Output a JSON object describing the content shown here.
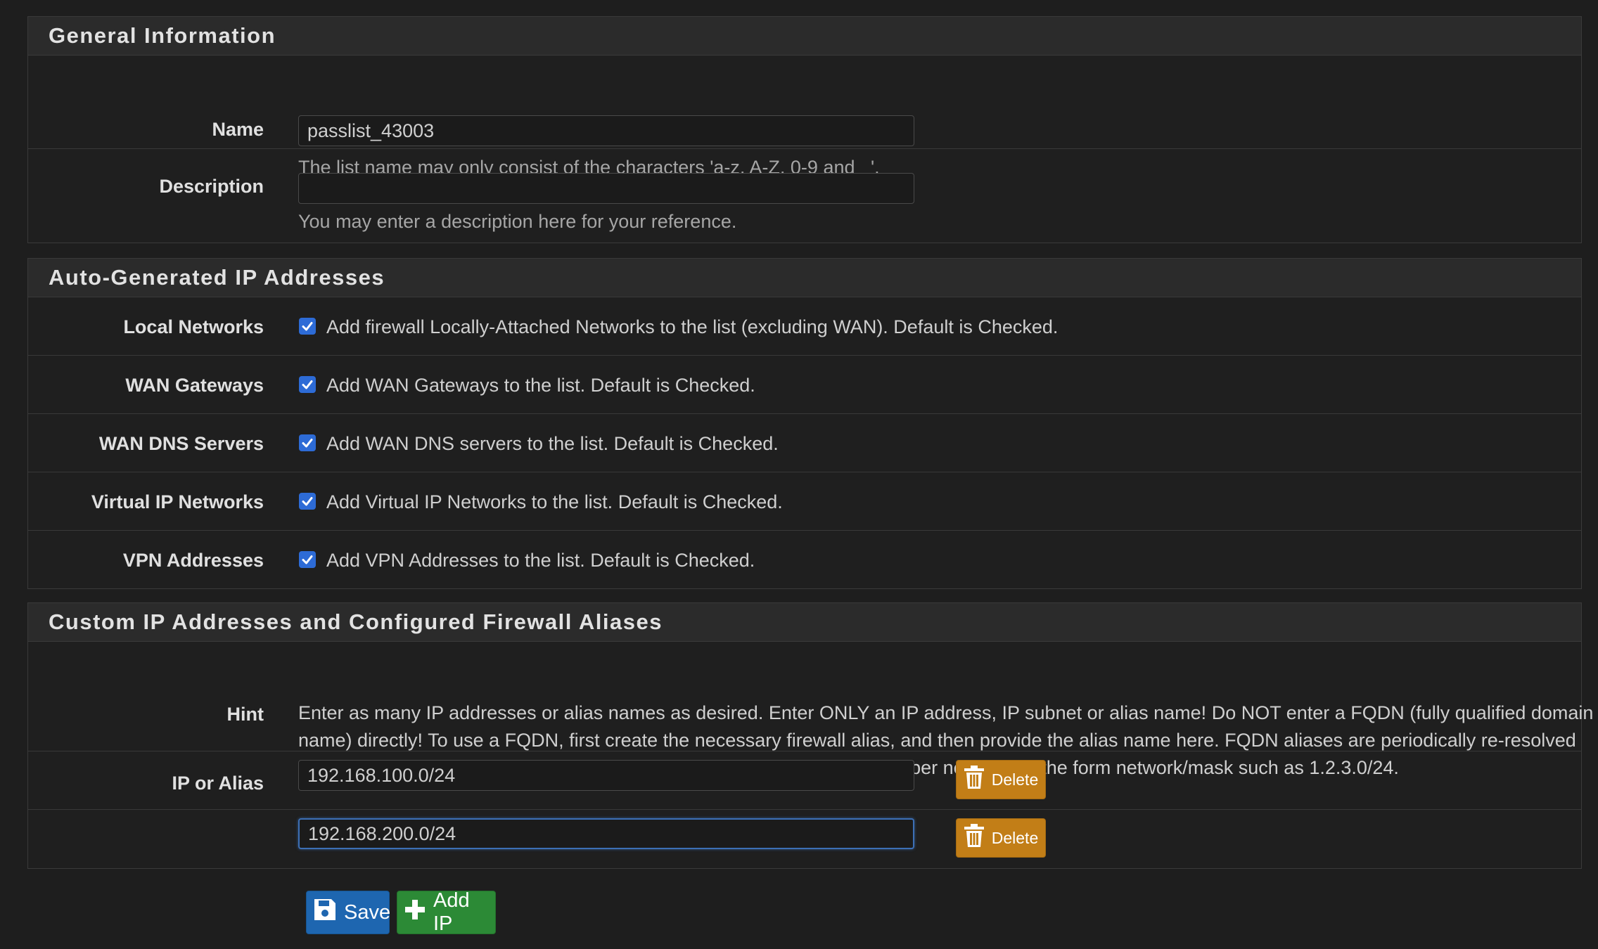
{
  "general": {
    "title": "General Information",
    "name_label": "Name",
    "name_value": "passlist_43003",
    "name_help": "The list name may only consist of the characters 'a-z, A-Z, 0-9 and _'.",
    "description_label": "Description",
    "description_value": "",
    "description_help": "You may enter a description here for your reference."
  },
  "auto": {
    "title": "Auto-Generated IP Addresses",
    "rows": [
      {
        "label": "Local Networks",
        "text": "Add firewall Locally-Attached Networks to the list (excluding WAN). Default is Checked.",
        "checked": true
      },
      {
        "label": "WAN Gateways",
        "text": "Add WAN Gateways to the list. Default is Checked.",
        "checked": true
      },
      {
        "label": "WAN DNS Servers",
        "text": "Add WAN DNS servers to the list. Default is Checked.",
        "checked": true
      },
      {
        "label": "Virtual IP Networks",
        "text": "Add Virtual IP Networks to the list. Default is Checked.",
        "checked": true
      },
      {
        "label": "VPN Addresses",
        "text": "Add VPN Addresses to the list. Default is Checked.",
        "checked": true
      }
    ]
  },
  "custom": {
    "title": "Custom IP Addresses and Configured Firewall Aliases",
    "hint_label": "Hint",
    "hint_text": "Enter as many IP addresses or alias names as desired. Enter ONLY an IP address, IP subnet or alias name! Do NOT enter a FQDN (fully qualified domain name) directly! To use a FQDN, first create the necessary firewall alias, and then provide the alias name here. FQDN aliases are periodically re-resolved and updated by the firewall. You can also provide an IP subnet with a proper netmask of the form network/mask such as 1.2.3.0/24.",
    "ip_label": "IP or Alias",
    "entries": [
      "192.168.100.0/24",
      "192.168.200.0/24"
    ],
    "delete_label": "Delete"
  },
  "actions": {
    "save_label": "Save",
    "add_ip_label": "Add IP"
  },
  "colors": {
    "checkbox": "#2d6bd6",
    "delete": "#c27e17",
    "save": "#1e66b0",
    "add": "#2c8a36"
  },
  "icons": {
    "delete": "trash-icon",
    "save": "floppy-disk-icon",
    "add": "plus-icon",
    "checkbox": "check-icon"
  }
}
